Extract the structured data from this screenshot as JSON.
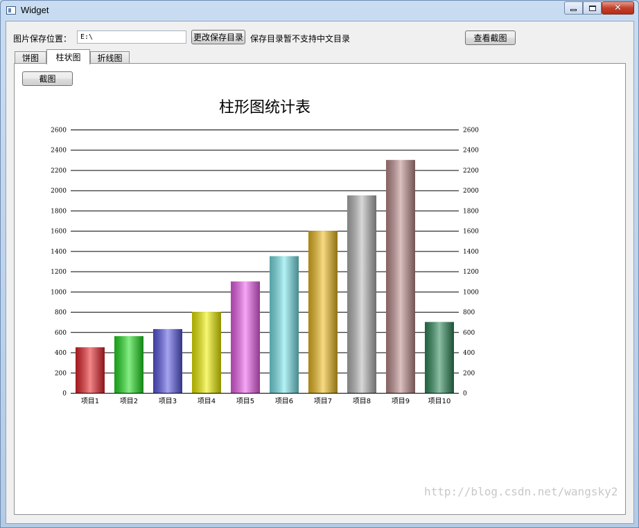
{
  "window": {
    "title": "Widget"
  },
  "toolbar": {
    "path_label": "图片保存位置：",
    "path_value": "E:\\",
    "change_dir_button": "更改保存目录",
    "note": "保存目录暂不支持中文目录",
    "view_screenshot_button": "查看截图"
  },
  "tabs": [
    {
      "label": "饼图"
    },
    {
      "label": "柱状图"
    },
    {
      "label": "折线图"
    }
  ],
  "panel": {
    "screenshot_button": "截图"
  },
  "watermark": "http://blog.csdn.net/wangsky2",
  "chart_data": {
    "type": "bar",
    "title": "柱形图统计表",
    "categories": [
      "项目1",
      "项目2",
      "项目3",
      "项目4",
      "项目5",
      "项目6",
      "项目7",
      "项目8",
      "项目9",
      "项目10"
    ],
    "values": [
      450,
      560,
      630,
      800,
      1100,
      1350,
      1600,
      1950,
      2300,
      700
    ],
    "colors": [
      "#e8242a",
      "#22e022",
      "#5a5ae6",
      "#f2f200",
      "#f060f0",
      "#7ae8ee",
      "#f2be20",
      "#b8b8b8",
      "#c08e8e",
      "#2e8a5a"
    ],
    "ylim": [
      0,
      2600
    ],
    "yticks": [
      0,
      200,
      400,
      600,
      800,
      1000,
      1200,
      1400,
      1600,
      1800,
      2000,
      2200,
      2400,
      2600
    ],
    "grid": true,
    "right_axis": true
  }
}
